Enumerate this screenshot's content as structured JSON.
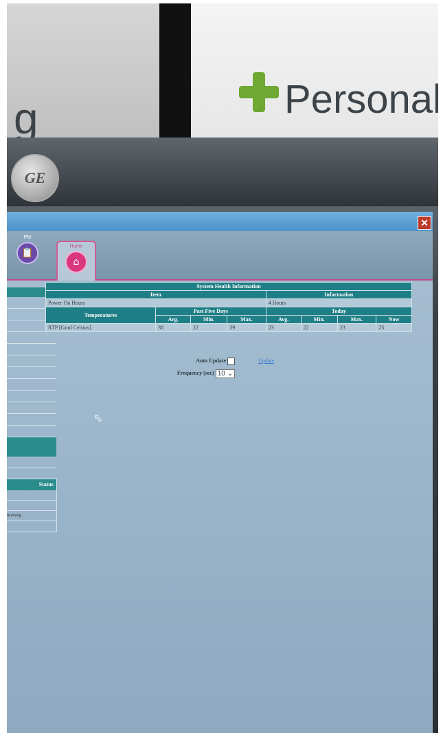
{
  "background": {
    "sign_left_text": "g",
    "sign_right_text": "Personal"
  },
  "monitor": {
    "logo_text": "GE"
  },
  "window": {
    "close_glyph": "✕"
  },
  "tabs": [
    {
      "label": "PM",
      "icon": "clipboard-icon"
    },
    {
      "label": "Home",
      "icon": "home-icon"
    }
  ],
  "status_panel": {
    "header": "Status",
    "rows": [
      "",
      "",
      "Running"
    ]
  },
  "health": {
    "title": "System Health Information",
    "item_header": "Item",
    "info_header": "Information",
    "power_label": "Power On Hours",
    "power_value": "4 Hours",
    "temp_header": "Temperatures",
    "past_header": "Past Five Days",
    "today_header": "Today",
    "col_avg": "Avg.",
    "col_min": "Min.",
    "col_max": "Max.",
    "col_now": "Now",
    "rtp_label": "RTP [Grad Celsius]",
    "past": {
      "avg": "38",
      "min": "22",
      "max": "39"
    },
    "today": {
      "avg": "23",
      "min": "22",
      "max": "23",
      "now": "23"
    }
  },
  "controls": {
    "auto_update_label": "Auto Update",
    "frequency_label": "Frequency (sec)",
    "frequency_value": "10",
    "update_link": "Update"
  }
}
